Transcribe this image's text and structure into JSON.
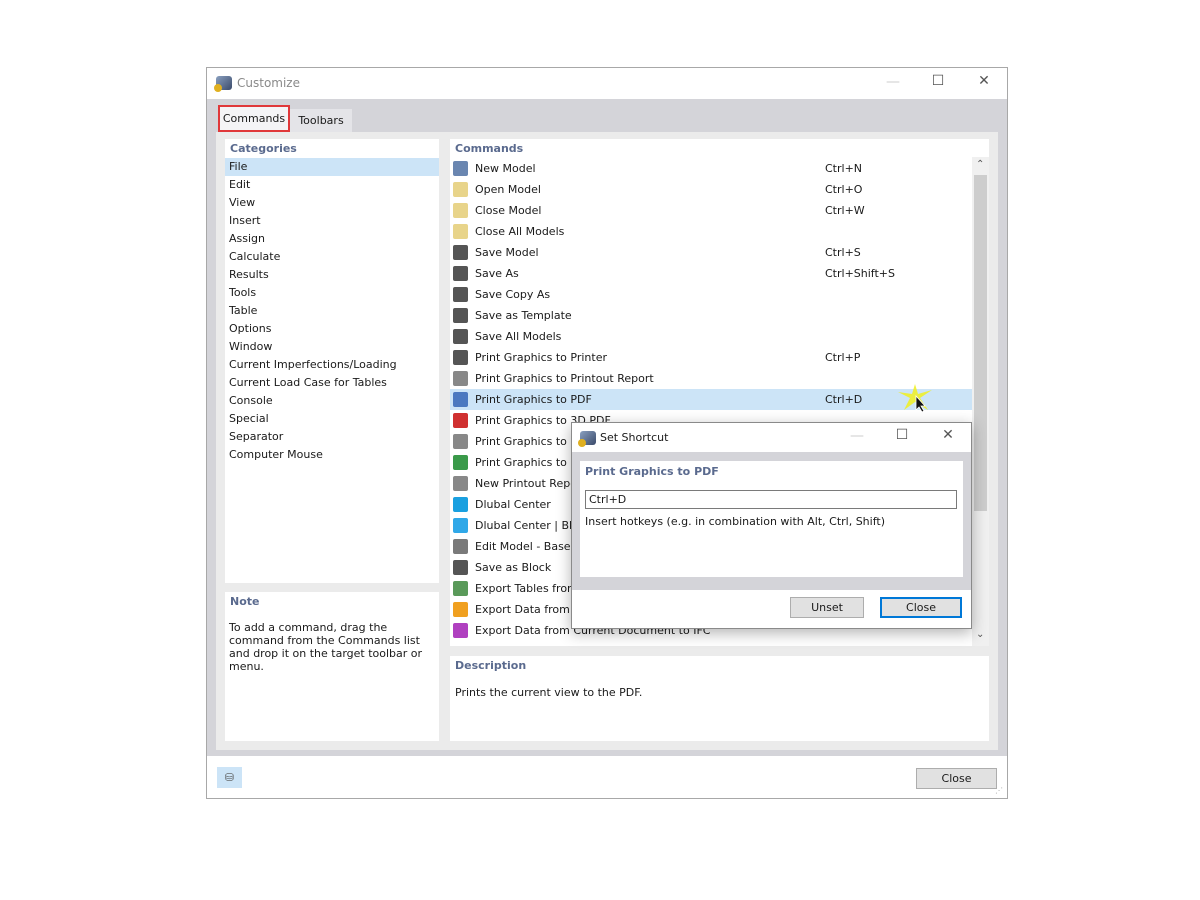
{
  "window": {
    "title": "Customize",
    "minimize": "—",
    "maximize": "☐",
    "close": "✕"
  },
  "tabs": [
    {
      "label": "Commands",
      "active": true
    },
    {
      "label": "Toolbars",
      "active": false
    }
  ],
  "categories": {
    "header": "Categories",
    "selected": "File",
    "items": [
      "File",
      "Edit",
      "View",
      "Insert",
      "Assign",
      "Calculate",
      "Results",
      "Tools",
      "Table",
      "Options",
      "Window",
      "Current Imperfections/Loading",
      "Current Load Case for Tables",
      "Console",
      "Special",
      "Separator",
      "Computer Mouse"
    ]
  },
  "commands": {
    "header": "Commands",
    "items": [
      {
        "label": "New Model",
        "shortcut": "Ctrl+N",
        "icon": "new-model-icon",
        "color": "#6a86b0"
      },
      {
        "label": "Open Model",
        "shortcut": "Ctrl+O",
        "icon": "open-folder-icon",
        "color": "#e8d48a"
      },
      {
        "label": "Close Model",
        "shortcut": "Ctrl+W",
        "icon": "close-folder-icon",
        "color": "#e8d48a"
      },
      {
        "label": "Close All Models",
        "shortcut": "",
        "icon": "close-all-folders-icon",
        "color": "#e8d48a"
      },
      {
        "label": "Save Model",
        "shortcut": "Ctrl+S",
        "icon": "save-icon",
        "color": "#555555"
      },
      {
        "label": "Save As",
        "shortcut": "Ctrl+Shift+S",
        "icon": "save-as-icon",
        "color": "#555555"
      },
      {
        "label": "Save Copy As",
        "shortcut": "",
        "icon": "save-copy-icon",
        "color": "#555555"
      },
      {
        "label": "Save as Template",
        "shortcut": "",
        "icon": "save-template-icon",
        "color": "#555555"
      },
      {
        "label": "Save All Models",
        "shortcut": "",
        "icon": "save-all-icon",
        "color": "#555555"
      },
      {
        "label": "Print Graphics to Printer",
        "shortcut": "Ctrl+P",
        "icon": "printer-icon",
        "color": "#555555"
      },
      {
        "label": "Print Graphics to Printout Report",
        "shortcut": "",
        "icon": "print-report-icon",
        "color": "#888888"
      },
      {
        "label": "Print Graphics to PDF",
        "shortcut": "Ctrl+D",
        "icon": "print-pdf-icon",
        "color": "#4a78c0",
        "selected": true
      },
      {
        "label": "Print Graphics to 3D PDF",
        "shortcut": "",
        "icon": "print-3d-pdf-icon",
        "color": "#d03030"
      },
      {
        "label": "Print Graphics to C",
        "shortcut": "",
        "icon": "print-clipboard-icon",
        "color": "#888888"
      },
      {
        "label": "Print Graphics to F",
        "shortcut": "",
        "icon": "print-file-icon",
        "color": "#3a9a4a"
      },
      {
        "label": "New Printout Repo",
        "shortcut": "",
        "icon": "new-printout-report-icon",
        "color": "#888888"
      },
      {
        "label": "Dlubal Center",
        "shortcut": "",
        "icon": "dlubal-center-icon",
        "color": "#1aa0e0"
      },
      {
        "label": "Dlubal Center | Blo",
        "shortcut": "",
        "icon": "dlubal-center-block-icon",
        "color": "#30a8e8"
      },
      {
        "label": "Edit Model - Base D",
        "shortcut": "",
        "icon": "edit-model-icon",
        "color": "#7a7a7a"
      },
      {
        "label": "Save as Block",
        "shortcut": "",
        "icon": "save-block-icon",
        "color": "#555555"
      },
      {
        "label": "Export Tables from",
        "shortcut": "",
        "icon": "export-tables-icon",
        "color": "#5a9a5a"
      },
      {
        "label": "Export Data from C",
        "shortcut": "",
        "icon": "export-xml-icon",
        "color": "#f0a020"
      },
      {
        "label": "Export Data from Current Document to IFC",
        "shortcut": "",
        "icon": "export-ifc-icon",
        "color": "#b040c0"
      }
    ]
  },
  "note": {
    "header": "Note",
    "text": "To add a command, drag the command from the Commands list and drop it on the target toolbar or menu."
  },
  "description": {
    "header": "Description",
    "text": "Prints the current view to the PDF."
  },
  "footer": {
    "close_label": "Close"
  },
  "dialog": {
    "title": "Set Shortcut",
    "command": "Print Graphics to PDF",
    "input_value": "Ctrl+D",
    "hint": "Insert hotkeys (e.g. in combination with Alt, Ctrl, Shift)",
    "unset_label": "Unset",
    "close_label": "Close",
    "minimize": "—",
    "maximize": "☐",
    "close": "✕"
  }
}
